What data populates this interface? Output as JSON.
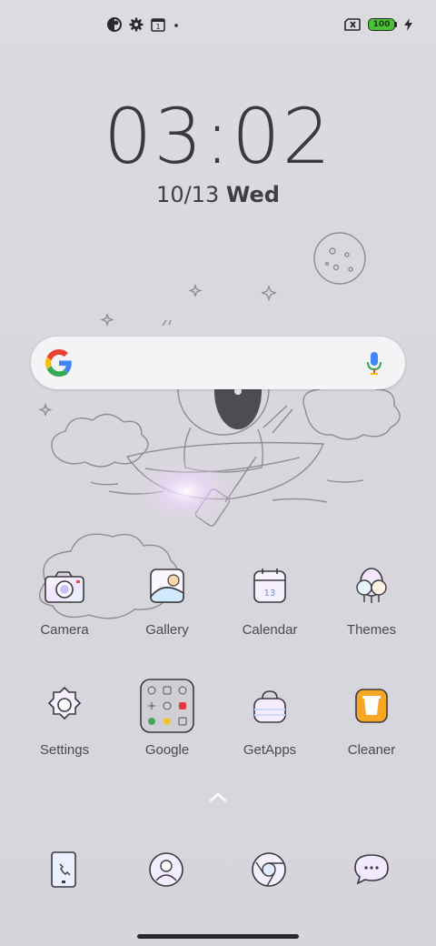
{
  "status_bar": {
    "left_icons": [
      "half-circle-icon",
      "gear-icon",
      "calendar-1-icon",
      "dot-icon"
    ],
    "right_icons": [
      "no-sim-icon",
      "battery-icon",
      "charging-icon"
    ],
    "battery_level": "100",
    "calendar_badge": "1"
  },
  "lockscreen": {
    "time": "03:02",
    "date": "10/13",
    "weekday": "Wed"
  },
  "search_bar": {
    "logo": "google-g-icon",
    "mic": "mic-icon"
  },
  "apps_row1": [
    {
      "label": "Camera",
      "icon": "camera-icon"
    },
    {
      "label": "Gallery",
      "icon": "gallery-icon"
    },
    {
      "label": "Calendar",
      "icon": "calendar-icon",
      "badge": "13"
    },
    {
      "label": "Themes",
      "icon": "themes-icon"
    }
  ],
  "apps_row2": [
    {
      "label": "Settings",
      "icon": "settings-icon"
    },
    {
      "label": "Google",
      "icon": "google-folder-icon"
    },
    {
      "label": "GetApps",
      "icon": "getapps-icon"
    },
    {
      "label": "Cleaner",
      "icon": "cleaner-icon"
    }
  ],
  "dock": [
    {
      "icon": "phone-icon"
    },
    {
      "icon": "contacts-icon"
    },
    {
      "icon": "chrome-icon"
    },
    {
      "icon": "messages-icon"
    }
  ],
  "colors": {
    "background": "#d8d7dd",
    "battery_fill": "#48c234",
    "google_blue": "#4285F4",
    "google_red": "#EA4335",
    "google_yellow": "#FBBC05",
    "google_green": "#34A853",
    "cleaner_orange": "#f6a623"
  }
}
